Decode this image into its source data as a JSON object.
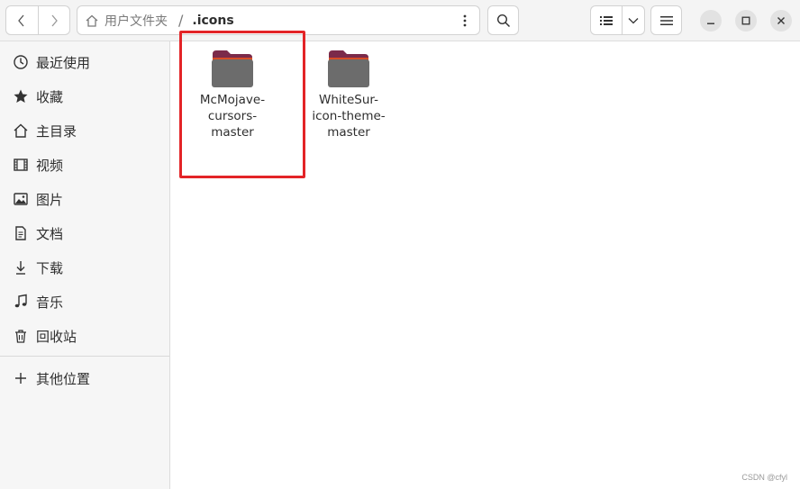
{
  "path": {
    "parent": "用户文件夹",
    "separator": "/",
    "current": ".icons"
  },
  "sidebar": {
    "items": [
      {
        "label": "最近使用",
        "icon": "clock-icon"
      },
      {
        "label": "收藏",
        "icon": "star-icon"
      },
      {
        "label": "主目录",
        "icon": "home-icon"
      },
      {
        "label": "视频",
        "icon": "film-icon"
      },
      {
        "label": "图片",
        "icon": "image-icon"
      },
      {
        "label": "文档",
        "icon": "document-icon"
      },
      {
        "label": "下载",
        "icon": "download-icon"
      },
      {
        "label": "音乐",
        "icon": "music-icon"
      },
      {
        "label": "回收站",
        "icon": "trash-icon"
      }
    ],
    "other": {
      "label": "其他位置",
      "icon": "plus-icon"
    }
  },
  "files": [
    {
      "name_lines": [
        "McMojave-",
        "cursors-",
        "master"
      ],
      "type": "folder",
      "highlighted": true
    },
    {
      "name_lines": [
        "WhiteSur-",
        "icon-theme-",
        "master"
      ],
      "type": "folder",
      "highlighted": false
    }
  ],
  "colors": {
    "folder_body": "#6c6c6c",
    "folder_tab": "#7b2a4a",
    "folder_accent": "#e95420",
    "highlight": "#e32427"
  },
  "watermark": "CSDN @cfyl"
}
